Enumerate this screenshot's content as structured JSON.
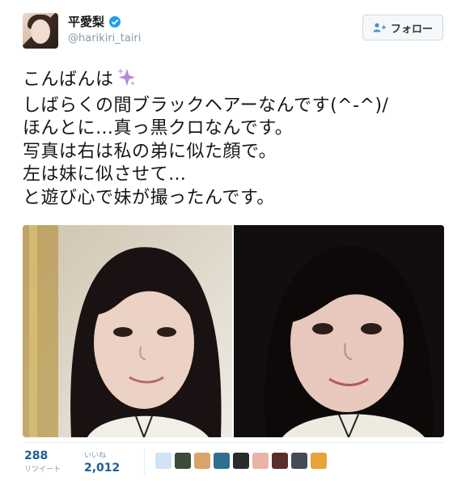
{
  "user": {
    "display_name": "平愛梨",
    "handle": "@harikiri_tairi",
    "verified": true
  },
  "follow_button": {
    "label": "フォロー",
    "icon": "add-user-icon"
  },
  "tweet": {
    "lines": [
      "こんばんは",
      "しばらくの間ブラックヘアーなんです(^-^)/",
      "ほんとに…真っ黒クロなんです。",
      "写真は右は私の弟に似た顔で。",
      "左は妹に似させて…",
      "と遊び心で妹が撮ったんです。"
    ],
    "emoji": "sparkles-icon"
  },
  "media": {
    "count": 2
  },
  "stats": {
    "retweets": {
      "count": "288",
      "label": "リツイート"
    },
    "likes": {
      "count": "2,012",
      "label": "いいね"
    }
  },
  "likers": [
    {
      "icon": "avatar-1",
      "color": "#cfe3f2"
    },
    {
      "icon": "avatar-2",
      "color": "#3d4a3c"
    },
    {
      "icon": "avatar-3",
      "color": "#d9a36a"
    },
    {
      "icon": "avatar-4",
      "color": "#2f6f8f"
    },
    {
      "icon": "avatar-5",
      "color": "#2b2b2b"
    },
    {
      "icon": "avatar-6",
      "color": "#e9b4a6"
    },
    {
      "icon": "avatar-7",
      "color": "#5a2d2d"
    },
    {
      "icon": "avatar-8",
      "color": "#444b55"
    },
    {
      "icon": "avatar-9",
      "color": "#e5a43c"
    }
  ],
  "colors": {
    "accent": "#1da1f2",
    "link": "#1b5e9b",
    "muted": "#8899a6"
  }
}
